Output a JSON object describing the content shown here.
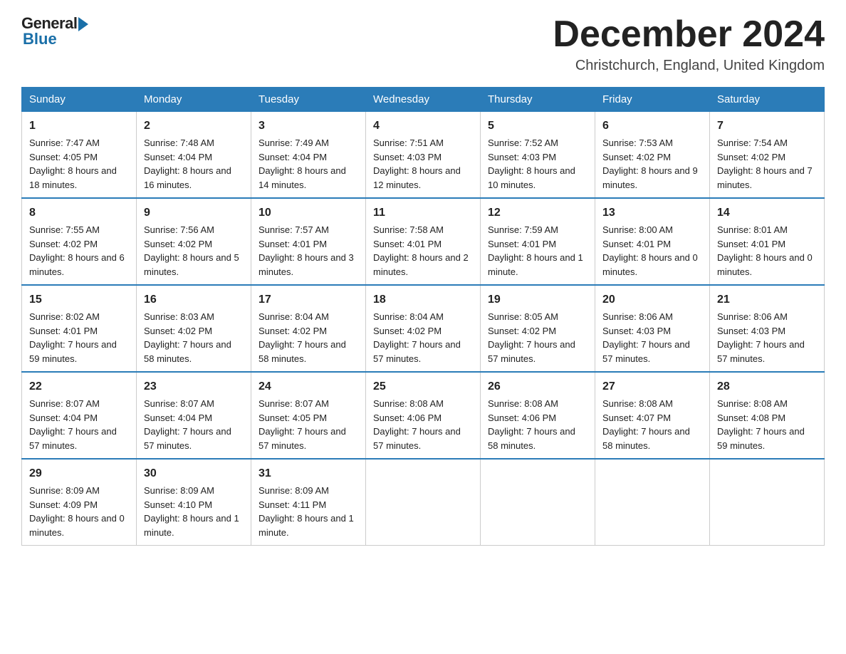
{
  "header": {
    "logo_general": "General",
    "logo_blue": "Blue",
    "month_title": "December 2024",
    "location": "Christchurch, England, United Kingdom"
  },
  "days_of_week": [
    "Sunday",
    "Monday",
    "Tuesday",
    "Wednesday",
    "Thursday",
    "Friday",
    "Saturday"
  ],
  "weeks": [
    [
      {
        "day": "1",
        "sunrise": "7:47 AM",
        "sunset": "4:05 PM",
        "daylight": "8 hours and 18 minutes."
      },
      {
        "day": "2",
        "sunrise": "7:48 AM",
        "sunset": "4:04 PM",
        "daylight": "8 hours and 16 minutes."
      },
      {
        "day": "3",
        "sunrise": "7:49 AM",
        "sunset": "4:04 PM",
        "daylight": "8 hours and 14 minutes."
      },
      {
        "day": "4",
        "sunrise": "7:51 AM",
        "sunset": "4:03 PM",
        "daylight": "8 hours and 12 minutes."
      },
      {
        "day": "5",
        "sunrise": "7:52 AM",
        "sunset": "4:03 PM",
        "daylight": "8 hours and 10 minutes."
      },
      {
        "day": "6",
        "sunrise": "7:53 AM",
        "sunset": "4:02 PM",
        "daylight": "8 hours and 9 minutes."
      },
      {
        "day": "7",
        "sunrise": "7:54 AM",
        "sunset": "4:02 PM",
        "daylight": "8 hours and 7 minutes."
      }
    ],
    [
      {
        "day": "8",
        "sunrise": "7:55 AM",
        "sunset": "4:02 PM",
        "daylight": "8 hours and 6 minutes."
      },
      {
        "day": "9",
        "sunrise": "7:56 AM",
        "sunset": "4:02 PM",
        "daylight": "8 hours and 5 minutes."
      },
      {
        "day": "10",
        "sunrise": "7:57 AM",
        "sunset": "4:01 PM",
        "daylight": "8 hours and 3 minutes."
      },
      {
        "day": "11",
        "sunrise": "7:58 AM",
        "sunset": "4:01 PM",
        "daylight": "8 hours and 2 minutes."
      },
      {
        "day": "12",
        "sunrise": "7:59 AM",
        "sunset": "4:01 PM",
        "daylight": "8 hours and 1 minute."
      },
      {
        "day": "13",
        "sunrise": "8:00 AM",
        "sunset": "4:01 PM",
        "daylight": "8 hours and 0 minutes."
      },
      {
        "day": "14",
        "sunrise": "8:01 AM",
        "sunset": "4:01 PM",
        "daylight": "8 hours and 0 minutes."
      }
    ],
    [
      {
        "day": "15",
        "sunrise": "8:02 AM",
        "sunset": "4:01 PM",
        "daylight": "7 hours and 59 minutes."
      },
      {
        "day": "16",
        "sunrise": "8:03 AM",
        "sunset": "4:02 PM",
        "daylight": "7 hours and 58 minutes."
      },
      {
        "day": "17",
        "sunrise": "8:04 AM",
        "sunset": "4:02 PM",
        "daylight": "7 hours and 58 minutes."
      },
      {
        "day": "18",
        "sunrise": "8:04 AM",
        "sunset": "4:02 PM",
        "daylight": "7 hours and 57 minutes."
      },
      {
        "day": "19",
        "sunrise": "8:05 AM",
        "sunset": "4:02 PM",
        "daylight": "7 hours and 57 minutes."
      },
      {
        "day": "20",
        "sunrise": "8:06 AM",
        "sunset": "4:03 PM",
        "daylight": "7 hours and 57 minutes."
      },
      {
        "day": "21",
        "sunrise": "8:06 AM",
        "sunset": "4:03 PM",
        "daylight": "7 hours and 57 minutes."
      }
    ],
    [
      {
        "day": "22",
        "sunrise": "8:07 AM",
        "sunset": "4:04 PM",
        "daylight": "7 hours and 57 minutes."
      },
      {
        "day": "23",
        "sunrise": "8:07 AM",
        "sunset": "4:04 PM",
        "daylight": "7 hours and 57 minutes."
      },
      {
        "day": "24",
        "sunrise": "8:07 AM",
        "sunset": "4:05 PM",
        "daylight": "7 hours and 57 minutes."
      },
      {
        "day": "25",
        "sunrise": "8:08 AM",
        "sunset": "4:06 PM",
        "daylight": "7 hours and 57 minutes."
      },
      {
        "day": "26",
        "sunrise": "8:08 AM",
        "sunset": "4:06 PM",
        "daylight": "7 hours and 58 minutes."
      },
      {
        "day": "27",
        "sunrise": "8:08 AM",
        "sunset": "4:07 PM",
        "daylight": "7 hours and 58 minutes."
      },
      {
        "day": "28",
        "sunrise": "8:08 AM",
        "sunset": "4:08 PM",
        "daylight": "7 hours and 59 minutes."
      }
    ],
    [
      {
        "day": "29",
        "sunrise": "8:09 AM",
        "sunset": "4:09 PM",
        "daylight": "8 hours and 0 minutes."
      },
      {
        "day": "30",
        "sunrise": "8:09 AM",
        "sunset": "4:10 PM",
        "daylight": "8 hours and 1 minute."
      },
      {
        "day": "31",
        "sunrise": "8:09 AM",
        "sunset": "4:11 PM",
        "daylight": "8 hours and 1 minute."
      },
      null,
      null,
      null,
      null
    ]
  ]
}
